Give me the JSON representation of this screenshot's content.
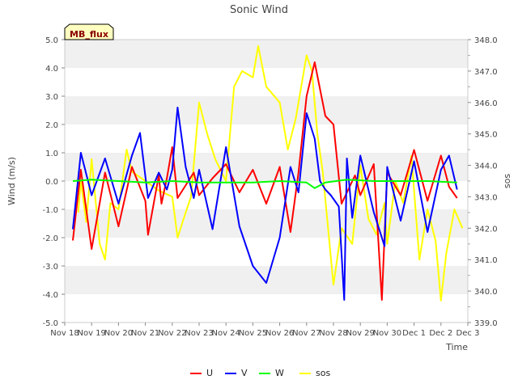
{
  "chart_data": {
    "type": "line",
    "title": "Sonic Wind",
    "xlabel": "Time",
    "ylabel_left": "Wind (m/s)",
    "ylabel_right": "sos",
    "site_label": "MB_flux",
    "x_ticks": [
      "Nov 18",
      "Nov 19",
      "Nov 20",
      "Nov 21",
      "Nov 22",
      "Nov 23",
      "Nov 24",
      "Nov 25",
      "Nov 26",
      "Nov 27",
      "Nov 28",
      "Nov 29",
      "Nov 30",
      "Dec 1",
      "Dec 2",
      "Dec 3"
    ],
    "xlim": [
      0,
      15
    ],
    "y_left_ticks": [
      "-5.0",
      "-4.0",
      "-3.0",
      "-2.0",
      "-1.0",
      "0.0",
      "1.0",
      "2.0",
      "3.0",
      "4.0",
      "5.0"
    ],
    "ylim_left": [
      -5,
      5
    ],
    "y_right_ticks": [
      "339.0",
      "340.0",
      "341.0",
      "342.0",
      "343.0",
      "344.0",
      "345.0",
      "346.0",
      "347.0",
      "348.0"
    ],
    "ylim_right": [
      339,
      348
    ],
    "grid": "horizontal bands",
    "legend_position": "bottom",
    "colors": {
      "U": "#ff0000",
      "V": "#0000ff",
      "W": "#00ff00",
      "sos": "#ffff00",
      "band": "#f0f0f0"
    },
    "series": [
      {
        "name": "U",
        "axis": "left",
        "x": [
          0.3,
          0.6,
          1.0,
          1.5,
          2.0,
          2.5,
          3.0,
          3.1,
          3.5,
          3.6,
          3.8,
          4.0,
          4.2,
          4.8,
          5.0,
          5.5,
          6.0,
          6.5,
          7.0,
          7.5,
          8.0,
          8.4,
          8.7,
          9.0,
          9.3,
          9.7,
          9.9,
          10.0,
          10.3,
          10.8,
          11.0,
          11.5,
          11.8,
          12.0,
          12.5,
          13.0,
          13.5,
          14.0,
          14.3,
          14.6
        ],
        "values": [
          -2.1,
          0.4,
          -2.4,
          0.3,
          -1.6,
          0.5,
          -0.7,
          -1.9,
          0.2,
          -0.8,
          0.1,
          1.2,
          -0.6,
          0.3,
          -0.5,
          0.1,
          0.6,
          -0.4,
          0.4,
          -0.8,
          0.5,
          -1.8,
          0.3,
          3.0,
          4.2,
          2.3,
          2.1,
          2.0,
          -0.8,
          0.2,
          -0.5,
          0.6,
          -4.2,
          0.3,
          -0.5,
          1.1,
          -0.7,
          0.9,
          -0.2,
          -0.6
        ]
      },
      {
        "name": "V",
        "axis": "left",
        "x": [
          0.3,
          0.6,
          1.0,
          1.5,
          2.0,
          2.5,
          2.8,
          3.1,
          3.5,
          3.8,
          4.0,
          4.2,
          4.5,
          4.8,
          5.0,
          5.5,
          6.0,
          6.5,
          7.0,
          7.5,
          8.0,
          8.4,
          8.7,
          9.0,
          9.3,
          9.5,
          9.7,
          9.9,
          10.2,
          10.4,
          10.5,
          10.7,
          11.0,
          11.5,
          11.9,
          12.0,
          12.5,
          13.0,
          13.5,
          14.0,
          14.3,
          14.6
        ],
        "values": [
          -1.7,
          1.0,
          -0.5,
          0.8,
          -0.8,
          0.9,
          1.7,
          -0.6,
          0.3,
          -0.3,
          0.4,
          2.6,
          0.5,
          -0.6,
          0.4,
          -1.7,
          1.2,
          -1.6,
          -3.0,
          -3.6,
          -2.0,
          0.5,
          -0.4,
          2.4,
          1.5,
          0.0,
          -0.3,
          -0.5,
          -0.9,
          -4.2,
          0.8,
          -1.3,
          0.9,
          -1.1,
          -2.3,
          0.5,
          -1.4,
          0.7,
          -1.8,
          0.4,
          0.9,
          -0.3
        ]
      },
      {
        "name": "W",
        "axis": "left",
        "x": [
          0.3,
          1.0,
          2.0,
          3.0,
          4.0,
          5.0,
          6.0,
          7.0,
          8.0,
          9.0,
          9.3,
          9.7,
          10.5,
          11.5,
          12.5,
          13.5,
          14.6
        ],
        "values": [
          0.0,
          0.05,
          0.0,
          -0.05,
          0.0,
          -0.05,
          -0.05,
          -0.05,
          0.0,
          -0.05,
          -0.25,
          -0.05,
          0.05,
          0.0,
          0.0,
          0.0,
          -0.05
        ]
      },
      {
        "name": "sos",
        "axis": "right",
        "x": [
          0.5,
          0.6,
          0.8,
          1.0,
          1.3,
          1.5,
          1.7,
          2.0,
          2.3,
          2.5,
          3.0,
          3.5,
          4.0,
          4.2,
          4.5,
          4.7,
          5.0,
          5.3,
          5.6,
          6.0,
          6.3,
          6.6,
          7.0,
          7.2,
          7.5,
          8.0,
          8.3,
          8.6,
          9.0,
          9.2,
          9.4,
          9.6,
          10.0,
          10.3,
          10.7,
          11.0,
          11.3,
          11.6,
          11.9,
          12.0,
          12.3,
          12.6,
          12.9,
          13.2,
          13.5,
          13.8,
          14.0,
          14.2,
          14.5,
          14.8
        ],
        "values": [
          342.5,
          343.5,
          342.2,
          344.2,
          341.5,
          341.0,
          342.8,
          342.6,
          344.5,
          343.8,
          343.5,
          343.2,
          343.0,
          341.7,
          342.5,
          343.0,
          346.0,
          345.0,
          344.2,
          343.5,
          346.5,
          347.0,
          346.8,
          347.8,
          346.5,
          346.0,
          344.5,
          345.5,
          347.5,
          347.0,
          345.0,
          343.8,
          340.2,
          342.0,
          341.5,
          344.0,
          342.3,
          341.8,
          342.8,
          341.5,
          343.5,
          342.8,
          344.3,
          341.0,
          342.6,
          341.6,
          339.7,
          341.2,
          342.6,
          342.0
        ]
      }
    ]
  }
}
